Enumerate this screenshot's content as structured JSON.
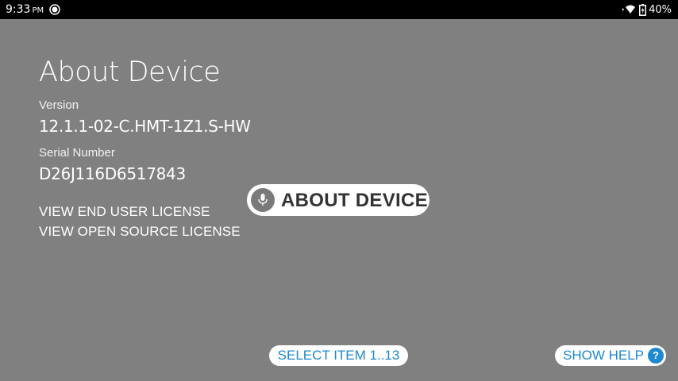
{
  "status_bar": {
    "time": "9:33",
    "ampm": "PM",
    "battery": "40%",
    "icons": [
      "app-notification-icon",
      "wifi-icon",
      "battery-charging-icon"
    ]
  },
  "page": {
    "title": "About Device",
    "version_label": "Version",
    "version_value": "12.1.1-02-C.HMT-1Z1.S-HW",
    "serial_label": "Serial Number",
    "serial_value": "D26J116D6517843",
    "eula_link": "VIEW END USER LICENSE",
    "oss_link": "VIEW OPEN SOURCE LICENSE"
  },
  "voice_overlay": {
    "command": "ABOUT DEVICE",
    "icon": "microphone-icon"
  },
  "hints": {
    "select_item": "SELECT ITEM 1..13",
    "show_help": "SHOW HELP",
    "help_badge": "?"
  },
  "colors": {
    "background": "#808080",
    "status_bar": "#000000",
    "accent": "#1e88d0",
    "voice_text": "#333333"
  }
}
